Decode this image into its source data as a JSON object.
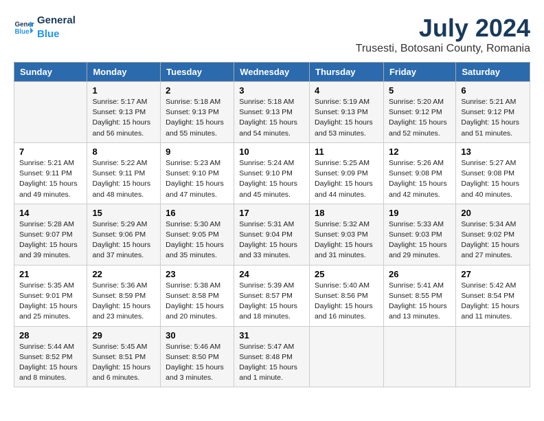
{
  "logo": {
    "line1": "General",
    "line2": "Blue"
  },
  "title": "July 2024",
  "subtitle": "Trusesti, Botosani County, Romania",
  "days_of_week": [
    "Sunday",
    "Monday",
    "Tuesday",
    "Wednesday",
    "Thursday",
    "Friday",
    "Saturday"
  ],
  "weeks": [
    [
      {
        "num": "",
        "sunrise": "",
        "sunset": "",
        "daylight": ""
      },
      {
        "num": "1",
        "sunrise": "Sunrise: 5:17 AM",
        "sunset": "Sunset: 9:13 PM",
        "daylight": "Daylight: 15 hours and 56 minutes."
      },
      {
        "num": "2",
        "sunrise": "Sunrise: 5:18 AM",
        "sunset": "Sunset: 9:13 PM",
        "daylight": "Daylight: 15 hours and 55 minutes."
      },
      {
        "num": "3",
        "sunrise": "Sunrise: 5:18 AM",
        "sunset": "Sunset: 9:13 PM",
        "daylight": "Daylight: 15 hours and 54 minutes."
      },
      {
        "num": "4",
        "sunrise": "Sunrise: 5:19 AM",
        "sunset": "Sunset: 9:13 PM",
        "daylight": "Daylight: 15 hours and 53 minutes."
      },
      {
        "num": "5",
        "sunrise": "Sunrise: 5:20 AM",
        "sunset": "Sunset: 9:12 PM",
        "daylight": "Daylight: 15 hours and 52 minutes."
      },
      {
        "num": "6",
        "sunrise": "Sunrise: 5:21 AM",
        "sunset": "Sunset: 9:12 PM",
        "daylight": "Daylight: 15 hours and 51 minutes."
      }
    ],
    [
      {
        "num": "7",
        "sunrise": "Sunrise: 5:21 AM",
        "sunset": "Sunset: 9:11 PM",
        "daylight": "Daylight: 15 hours and 49 minutes."
      },
      {
        "num": "8",
        "sunrise": "Sunrise: 5:22 AM",
        "sunset": "Sunset: 9:11 PM",
        "daylight": "Daylight: 15 hours and 48 minutes."
      },
      {
        "num": "9",
        "sunrise": "Sunrise: 5:23 AM",
        "sunset": "Sunset: 9:10 PM",
        "daylight": "Daylight: 15 hours and 47 minutes."
      },
      {
        "num": "10",
        "sunrise": "Sunrise: 5:24 AM",
        "sunset": "Sunset: 9:10 PM",
        "daylight": "Daylight: 15 hours and 45 minutes."
      },
      {
        "num": "11",
        "sunrise": "Sunrise: 5:25 AM",
        "sunset": "Sunset: 9:09 PM",
        "daylight": "Daylight: 15 hours and 44 minutes."
      },
      {
        "num": "12",
        "sunrise": "Sunrise: 5:26 AM",
        "sunset": "Sunset: 9:08 PM",
        "daylight": "Daylight: 15 hours and 42 minutes."
      },
      {
        "num": "13",
        "sunrise": "Sunrise: 5:27 AM",
        "sunset": "Sunset: 9:08 PM",
        "daylight": "Daylight: 15 hours and 40 minutes."
      }
    ],
    [
      {
        "num": "14",
        "sunrise": "Sunrise: 5:28 AM",
        "sunset": "Sunset: 9:07 PM",
        "daylight": "Daylight: 15 hours and 39 minutes."
      },
      {
        "num": "15",
        "sunrise": "Sunrise: 5:29 AM",
        "sunset": "Sunset: 9:06 PM",
        "daylight": "Daylight: 15 hours and 37 minutes."
      },
      {
        "num": "16",
        "sunrise": "Sunrise: 5:30 AM",
        "sunset": "Sunset: 9:05 PM",
        "daylight": "Daylight: 15 hours and 35 minutes."
      },
      {
        "num": "17",
        "sunrise": "Sunrise: 5:31 AM",
        "sunset": "Sunset: 9:04 PM",
        "daylight": "Daylight: 15 hours and 33 minutes."
      },
      {
        "num": "18",
        "sunrise": "Sunrise: 5:32 AM",
        "sunset": "Sunset: 9:03 PM",
        "daylight": "Daylight: 15 hours and 31 minutes."
      },
      {
        "num": "19",
        "sunrise": "Sunrise: 5:33 AM",
        "sunset": "Sunset: 9:03 PM",
        "daylight": "Daylight: 15 hours and 29 minutes."
      },
      {
        "num": "20",
        "sunrise": "Sunrise: 5:34 AM",
        "sunset": "Sunset: 9:02 PM",
        "daylight": "Daylight: 15 hours and 27 minutes."
      }
    ],
    [
      {
        "num": "21",
        "sunrise": "Sunrise: 5:35 AM",
        "sunset": "Sunset: 9:01 PM",
        "daylight": "Daylight: 15 hours and 25 minutes."
      },
      {
        "num": "22",
        "sunrise": "Sunrise: 5:36 AM",
        "sunset": "Sunset: 8:59 PM",
        "daylight": "Daylight: 15 hours and 23 minutes."
      },
      {
        "num": "23",
        "sunrise": "Sunrise: 5:38 AM",
        "sunset": "Sunset: 8:58 PM",
        "daylight": "Daylight: 15 hours and 20 minutes."
      },
      {
        "num": "24",
        "sunrise": "Sunrise: 5:39 AM",
        "sunset": "Sunset: 8:57 PM",
        "daylight": "Daylight: 15 hours and 18 minutes."
      },
      {
        "num": "25",
        "sunrise": "Sunrise: 5:40 AM",
        "sunset": "Sunset: 8:56 PM",
        "daylight": "Daylight: 15 hours and 16 minutes."
      },
      {
        "num": "26",
        "sunrise": "Sunrise: 5:41 AM",
        "sunset": "Sunset: 8:55 PM",
        "daylight": "Daylight: 15 hours and 13 minutes."
      },
      {
        "num": "27",
        "sunrise": "Sunrise: 5:42 AM",
        "sunset": "Sunset: 8:54 PM",
        "daylight": "Daylight: 15 hours and 11 minutes."
      }
    ],
    [
      {
        "num": "28",
        "sunrise": "Sunrise: 5:44 AM",
        "sunset": "Sunset: 8:52 PM",
        "daylight": "Daylight: 15 hours and 8 minutes."
      },
      {
        "num": "29",
        "sunrise": "Sunrise: 5:45 AM",
        "sunset": "Sunset: 8:51 PM",
        "daylight": "Daylight: 15 hours and 6 minutes."
      },
      {
        "num": "30",
        "sunrise": "Sunrise: 5:46 AM",
        "sunset": "Sunset: 8:50 PM",
        "daylight": "Daylight: 15 hours and 3 minutes."
      },
      {
        "num": "31",
        "sunrise": "Sunrise: 5:47 AM",
        "sunset": "Sunset: 8:48 PM",
        "daylight": "Daylight: 15 hours and 1 minute."
      },
      {
        "num": "",
        "sunrise": "",
        "sunset": "",
        "daylight": ""
      },
      {
        "num": "",
        "sunrise": "",
        "sunset": "",
        "daylight": ""
      },
      {
        "num": "",
        "sunrise": "",
        "sunset": "",
        "daylight": ""
      }
    ]
  ]
}
